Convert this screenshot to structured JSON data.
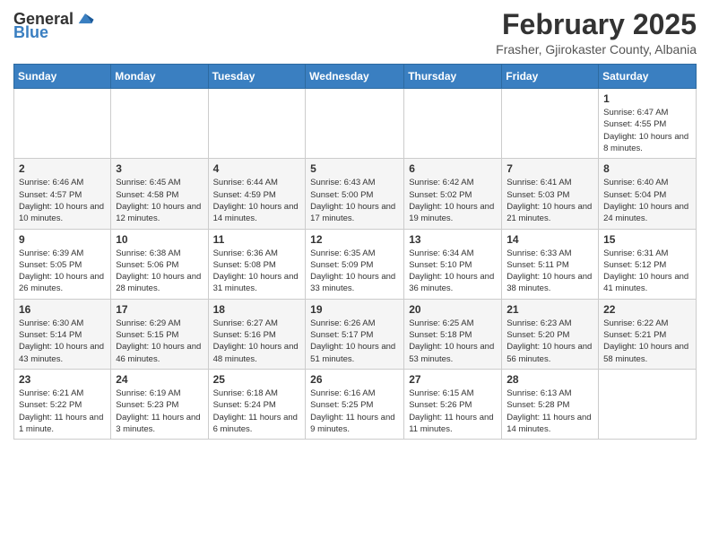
{
  "header": {
    "logo_general": "General",
    "logo_blue": "Blue",
    "month_title": "February 2025",
    "location": "Frasher, Gjirokaster County, Albania"
  },
  "weekdays": [
    "Sunday",
    "Monday",
    "Tuesday",
    "Wednesday",
    "Thursday",
    "Friday",
    "Saturday"
  ],
  "weeks": [
    [
      {
        "day": "",
        "info": ""
      },
      {
        "day": "",
        "info": ""
      },
      {
        "day": "",
        "info": ""
      },
      {
        "day": "",
        "info": ""
      },
      {
        "day": "",
        "info": ""
      },
      {
        "day": "",
        "info": ""
      },
      {
        "day": "1",
        "info": "Sunrise: 6:47 AM\nSunset: 4:55 PM\nDaylight: 10 hours and 8 minutes."
      }
    ],
    [
      {
        "day": "2",
        "info": "Sunrise: 6:46 AM\nSunset: 4:57 PM\nDaylight: 10 hours and 10 minutes."
      },
      {
        "day": "3",
        "info": "Sunrise: 6:45 AM\nSunset: 4:58 PM\nDaylight: 10 hours and 12 minutes."
      },
      {
        "day": "4",
        "info": "Sunrise: 6:44 AM\nSunset: 4:59 PM\nDaylight: 10 hours and 14 minutes."
      },
      {
        "day": "5",
        "info": "Sunrise: 6:43 AM\nSunset: 5:00 PM\nDaylight: 10 hours and 17 minutes."
      },
      {
        "day": "6",
        "info": "Sunrise: 6:42 AM\nSunset: 5:02 PM\nDaylight: 10 hours and 19 minutes."
      },
      {
        "day": "7",
        "info": "Sunrise: 6:41 AM\nSunset: 5:03 PM\nDaylight: 10 hours and 21 minutes."
      },
      {
        "day": "8",
        "info": "Sunrise: 6:40 AM\nSunset: 5:04 PM\nDaylight: 10 hours and 24 minutes."
      }
    ],
    [
      {
        "day": "9",
        "info": "Sunrise: 6:39 AM\nSunset: 5:05 PM\nDaylight: 10 hours and 26 minutes."
      },
      {
        "day": "10",
        "info": "Sunrise: 6:38 AM\nSunset: 5:06 PM\nDaylight: 10 hours and 28 minutes."
      },
      {
        "day": "11",
        "info": "Sunrise: 6:36 AM\nSunset: 5:08 PM\nDaylight: 10 hours and 31 minutes."
      },
      {
        "day": "12",
        "info": "Sunrise: 6:35 AM\nSunset: 5:09 PM\nDaylight: 10 hours and 33 minutes."
      },
      {
        "day": "13",
        "info": "Sunrise: 6:34 AM\nSunset: 5:10 PM\nDaylight: 10 hours and 36 minutes."
      },
      {
        "day": "14",
        "info": "Sunrise: 6:33 AM\nSunset: 5:11 PM\nDaylight: 10 hours and 38 minutes."
      },
      {
        "day": "15",
        "info": "Sunrise: 6:31 AM\nSunset: 5:12 PM\nDaylight: 10 hours and 41 minutes."
      }
    ],
    [
      {
        "day": "16",
        "info": "Sunrise: 6:30 AM\nSunset: 5:14 PM\nDaylight: 10 hours and 43 minutes."
      },
      {
        "day": "17",
        "info": "Sunrise: 6:29 AM\nSunset: 5:15 PM\nDaylight: 10 hours and 46 minutes."
      },
      {
        "day": "18",
        "info": "Sunrise: 6:27 AM\nSunset: 5:16 PM\nDaylight: 10 hours and 48 minutes."
      },
      {
        "day": "19",
        "info": "Sunrise: 6:26 AM\nSunset: 5:17 PM\nDaylight: 10 hours and 51 minutes."
      },
      {
        "day": "20",
        "info": "Sunrise: 6:25 AM\nSunset: 5:18 PM\nDaylight: 10 hours and 53 minutes."
      },
      {
        "day": "21",
        "info": "Sunrise: 6:23 AM\nSunset: 5:20 PM\nDaylight: 10 hours and 56 minutes."
      },
      {
        "day": "22",
        "info": "Sunrise: 6:22 AM\nSunset: 5:21 PM\nDaylight: 10 hours and 58 minutes."
      }
    ],
    [
      {
        "day": "23",
        "info": "Sunrise: 6:21 AM\nSunset: 5:22 PM\nDaylight: 11 hours and 1 minute."
      },
      {
        "day": "24",
        "info": "Sunrise: 6:19 AM\nSunset: 5:23 PM\nDaylight: 11 hours and 3 minutes."
      },
      {
        "day": "25",
        "info": "Sunrise: 6:18 AM\nSunset: 5:24 PM\nDaylight: 11 hours and 6 minutes."
      },
      {
        "day": "26",
        "info": "Sunrise: 6:16 AM\nSunset: 5:25 PM\nDaylight: 11 hours and 9 minutes."
      },
      {
        "day": "27",
        "info": "Sunrise: 6:15 AM\nSunset: 5:26 PM\nDaylight: 11 hours and 11 minutes."
      },
      {
        "day": "28",
        "info": "Sunrise: 6:13 AM\nSunset: 5:28 PM\nDaylight: 11 hours and 14 minutes."
      },
      {
        "day": "",
        "info": ""
      }
    ]
  ]
}
